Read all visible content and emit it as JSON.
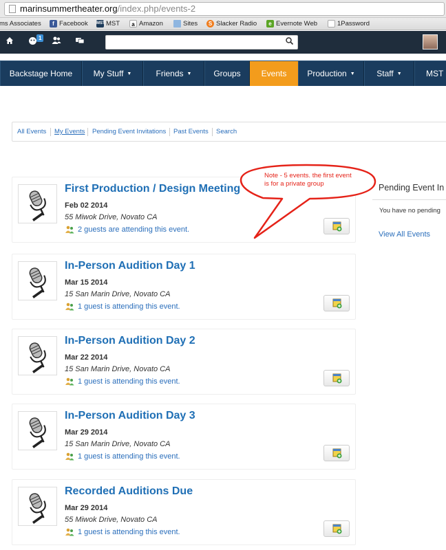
{
  "browser": {
    "url_host": "marinsummertheater.org",
    "url_path": "/index.php/events-2"
  },
  "bookmarks": [
    {
      "label": "ms Associates",
      "icon": "none"
    },
    {
      "label": "Facebook",
      "icon": "facebook-icon"
    },
    {
      "label": "MST",
      "icon": "mst-icon"
    },
    {
      "label": "Amazon",
      "icon": "amazon-icon"
    },
    {
      "label": "Sites",
      "icon": "folder-icon"
    },
    {
      "label": "Slacker Radio",
      "icon": "slacker-icon"
    },
    {
      "label": "Evernote Web",
      "icon": "evernote-icon"
    },
    {
      "label": "1Password",
      "icon": "page-icon"
    }
  ],
  "topbar": {
    "notification_count": "1",
    "search_placeholder": ""
  },
  "nav": [
    {
      "label": "Backstage Home",
      "dropdown": false,
      "active": false
    },
    {
      "label": "My Stuff",
      "dropdown": true,
      "active": false
    },
    {
      "label": "Friends",
      "dropdown": true,
      "active": false
    },
    {
      "label": "Groups",
      "dropdown": false,
      "active": false
    },
    {
      "label": "Events",
      "dropdown": false,
      "active": true
    },
    {
      "label": "Production",
      "dropdown": true,
      "active": false
    },
    {
      "label": "Staff",
      "dropdown": true,
      "active": false
    },
    {
      "label": "MST H",
      "dropdown": false,
      "active": false
    }
  ],
  "subnav": [
    {
      "label": "All Events"
    },
    {
      "label": "My Events"
    },
    {
      "label": "Pending Event Invitations"
    },
    {
      "label": "Past Events"
    },
    {
      "label": "Search"
    }
  ],
  "events": [
    {
      "title": "First Production / Design Meeting",
      "date": "Feb 02 2014",
      "location": "55 Miwok Drive, Novato CA",
      "guests": "2 guests are attending this event."
    },
    {
      "title": "In-Person Audition Day 1",
      "date": "Mar 15 2014",
      "location": "15 San Marin Drive, Novato CA",
      "guests": "1 guest is attending this event."
    },
    {
      "title": "In-Person Audition Day 2",
      "date": "Mar 22 2014",
      "location": "15 San Marin Drive, Novato CA",
      "guests": "1 guest is attending this event."
    },
    {
      "title": "In-Person Audition Day 3",
      "date": "Mar 29 2014",
      "location": "15 San Marin Drive, Novato CA",
      "guests": "1 guest is attending this event."
    },
    {
      "title": "Recorded Auditions Due",
      "date": "Mar 29 2014",
      "location": "55 Miwok Drive, Novato CA",
      "guests": "1 guest is attending this event."
    }
  ],
  "pending_panel": {
    "title": "Pending Event In",
    "empty_text": "You have no pending",
    "link": "View All Events"
  },
  "annotation": {
    "text": "Note - 5 events.  the first event is for a private group",
    "color": "#e52218"
  },
  "colors": {
    "topbar": "#1f2d3c",
    "nav": "#1a3c5e",
    "active_tab": "#f39c1c",
    "link": "#2a6ebb",
    "title": "#1f6fb5"
  }
}
